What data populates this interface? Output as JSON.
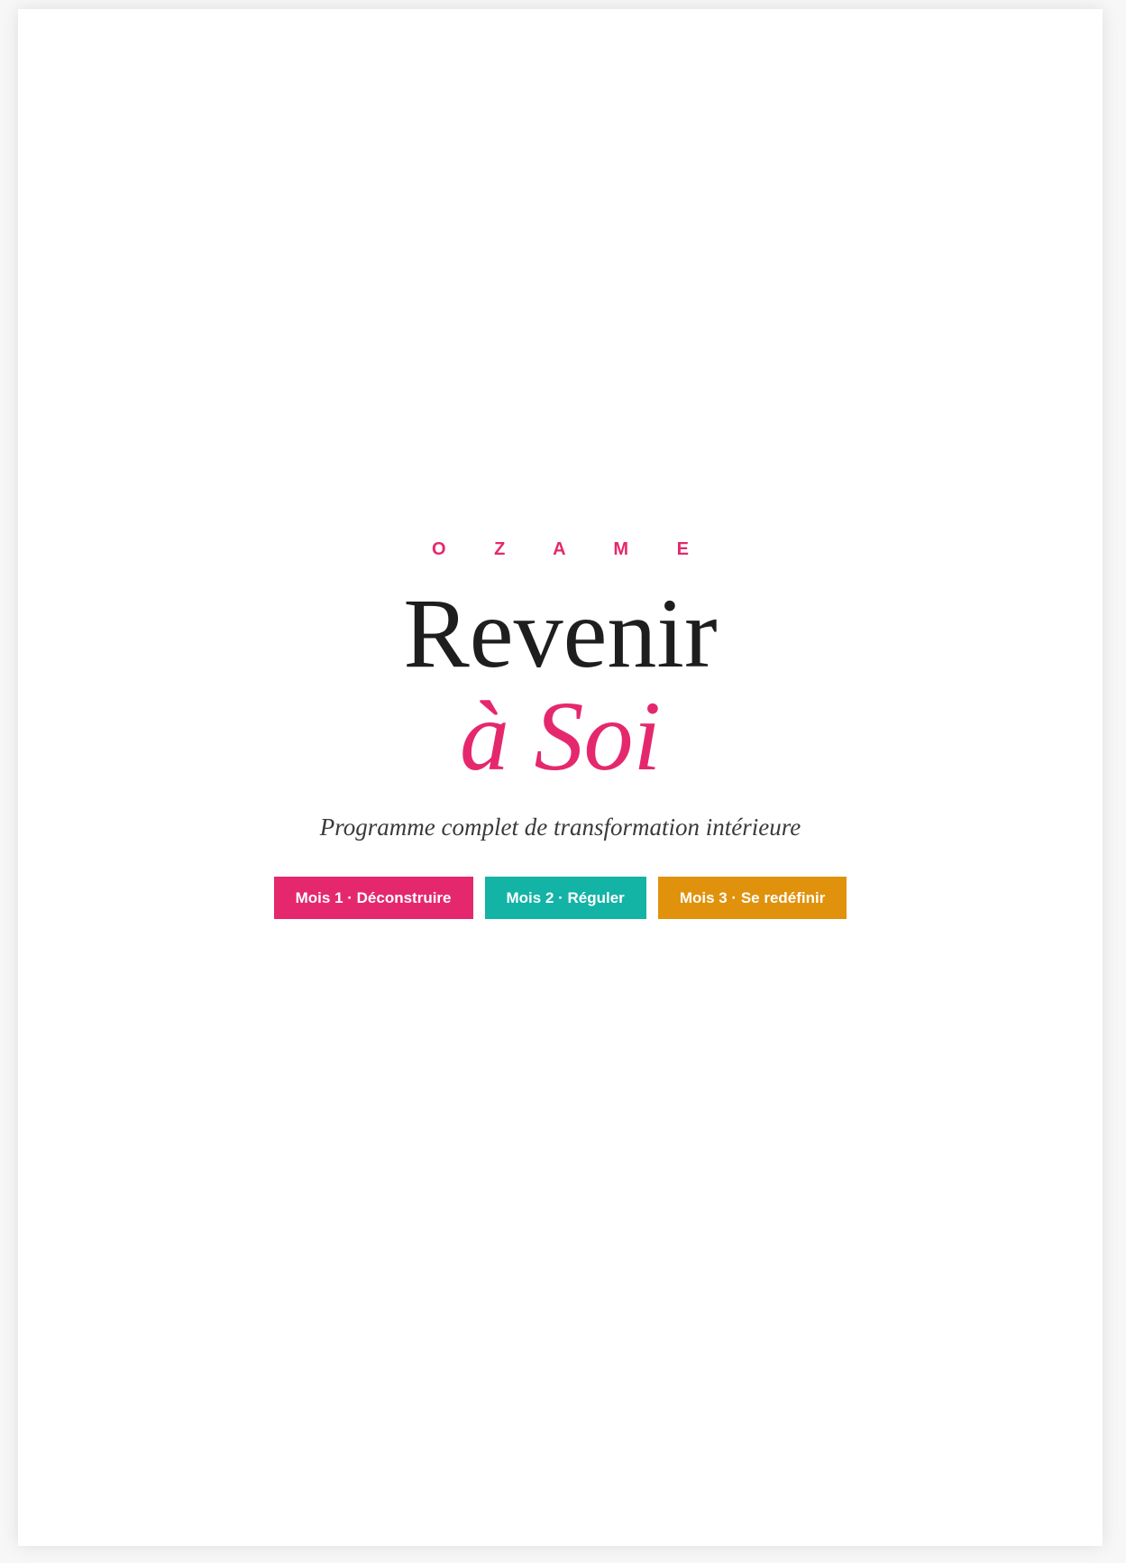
{
  "cover": {
    "brand": "O Z A M E",
    "title_line1": "Revenir",
    "title_line2": "à Soi",
    "subtitle": "Programme complet de transformation intérieure"
  },
  "modules": [
    {
      "label": "Mois 1 · Déconstruire",
      "color": "#e5286d"
    },
    {
      "label": "Mois 2 · Réguler",
      "color": "#13b3a6"
    },
    {
      "label": "Mois 3 · Se redéfinir",
      "color": "#e0920c"
    }
  ],
  "colors": {
    "accent": "#e5286d",
    "text": "#1e1e1e",
    "page_background": "#ffffff"
  }
}
